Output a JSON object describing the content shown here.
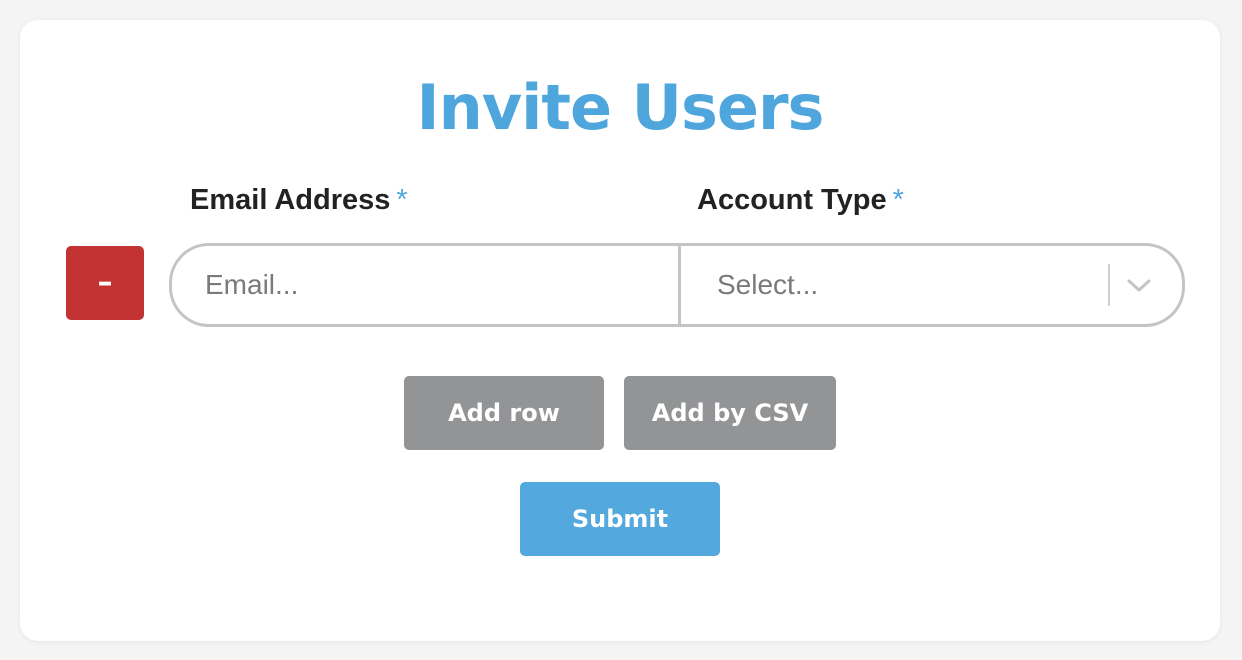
{
  "form": {
    "title": "Invite Users",
    "email_label": "Email Address",
    "account_type_label": "Account Type",
    "required_marker": "*",
    "row": {
      "remove_label": "–",
      "email_value": "",
      "email_placeholder": "Email...",
      "account_type_value": "Select..."
    },
    "add_row_label": "Add row",
    "add_csv_label": "Add by CSV",
    "submit_label": "Submit"
  },
  "icons": {
    "select_arrow": "chevron-down-icon"
  },
  "colors": {
    "title": "#4fa6dd",
    "required": "#4fa6dd",
    "remove_button": "#c23232",
    "secondary_button": "#939496",
    "submit_button": "#53a8de",
    "border": "#c4c4c4",
    "chevron": "#c4c4c4"
  }
}
